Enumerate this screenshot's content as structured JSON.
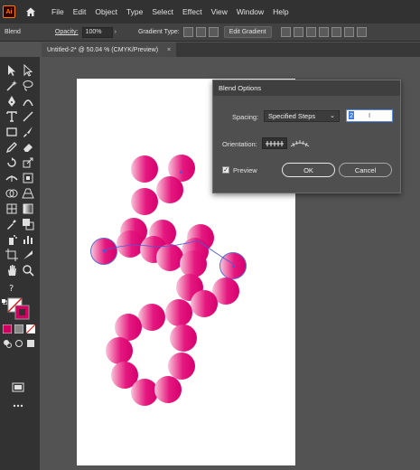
{
  "app": {
    "logo_text": "Ai"
  },
  "menu": [
    "File",
    "Edit",
    "Object",
    "Type",
    "Select",
    "Effect",
    "View",
    "Window",
    "Help"
  ],
  "control_bar": {
    "selection_label": "Blend",
    "opacity_label": "Opacity:",
    "opacity_value": "100%",
    "gradient_type_label": "Gradient Type:",
    "edit_gradient_label": "Edit Gradient"
  },
  "document_tab": {
    "title": "Untitled-2* @ 50.04 % (CMYK/Preview)",
    "close_glyph": "×"
  },
  "dialog": {
    "title": "Blend Options",
    "spacing_label": "Spacing:",
    "spacing_value": "Specified Steps",
    "steps_value": "2",
    "orientation_label": "Orientation:",
    "preview_label": "Preview",
    "preview_checked": true,
    "ok_label": "OK",
    "cancel_label": "Cancel"
  },
  "colors": {
    "accent_pink": "#e5177f",
    "selection_blue": "#4a5bd8",
    "panel_bg": "#535353"
  },
  "icons": [
    "home-icon",
    "selection-tool-icon",
    "direct-selection-tool-icon",
    "magic-wand-icon",
    "lasso-icon",
    "pen-tool-icon",
    "curvature-tool-icon",
    "type-tool-icon",
    "line-tool-icon",
    "rectangle-tool-icon",
    "paintbrush-icon",
    "pencil-icon",
    "eraser-icon",
    "rotate-tool-icon",
    "scale-tool-icon",
    "width-tool-icon",
    "free-transform-icon",
    "shape-builder-icon",
    "perspective-grid-icon",
    "mesh-tool-icon",
    "gradient-tool-icon",
    "eyedropper-icon",
    "blend-tool-icon",
    "symbol-sprayer-icon",
    "graph-tool-icon",
    "artboard-tool-icon",
    "slice-tool-icon",
    "hand-tool-icon",
    "zoom-tool-icon",
    "fill-stroke-icon",
    "more-tools-icon"
  ]
}
